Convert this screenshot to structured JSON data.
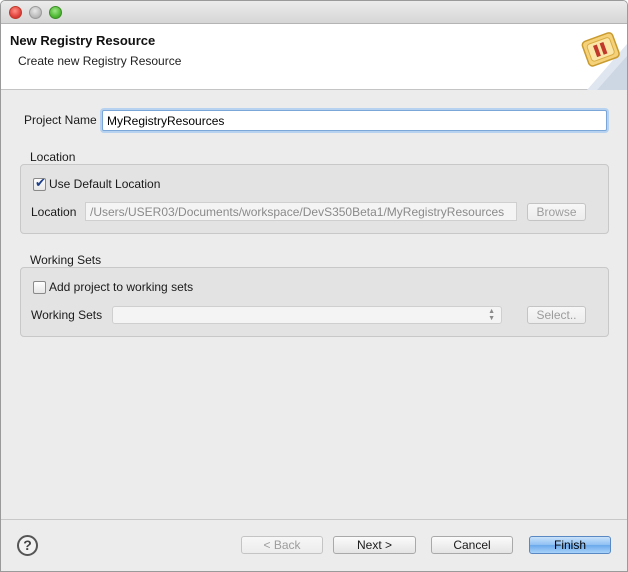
{
  "window": {
    "controls": [
      "close",
      "minimize",
      "maximize"
    ]
  },
  "banner": {
    "title": "New Registry Resource",
    "subtitle": "Create new Registry Resource",
    "icon": "wizard-banner-icon"
  },
  "project": {
    "label": "Project Name",
    "value": "MyRegistryResources"
  },
  "location_group": {
    "title": "Location",
    "use_default_label": "Use Default Location",
    "use_default_checked": true,
    "location_label": "Location",
    "location_value": "/Users/USER03/Documents/workspace/DevS350Beta1/MyRegistryResources",
    "browse_label": "Browse"
  },
  "working_sets_group": {
    "title": "Working Sets",
    "add_label": "Add project to working sets",
    "add_checked": false,
    "working_sets_label": "Working Sets",
    "working_sets_value": "",
    "select_label": "Select.."
  },
  "footer": {
    "help_icon": "?",
    "back_label": "< Back",
    "next_label": "Next >",
    "cancel_label": "Cancel",
    "finish_label": "Finish"
  },
  "colors": {
    "accent": "#6aa9eb",
    "focus_ring": "#b7d2f0"
  }
}
